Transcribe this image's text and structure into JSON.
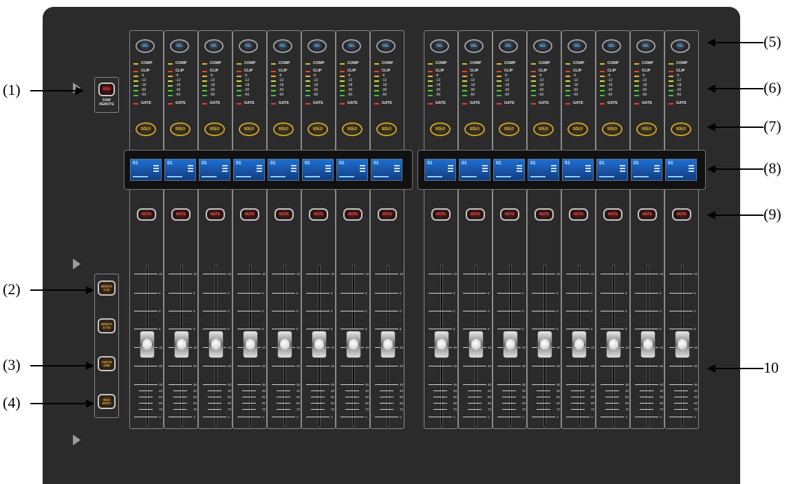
{
  "strips_left_count": 8,
  "strips_right_count": 8,
  "strip": {
    "sel_label": "SEL",
    "solo_label": "SOLO",
    "mute_label": "MUTE",
    "meter_labels": [
      "COMP",
      "CLIP",
      "-6",
      "-12",
      "-18",
      "-30",
      "-60",
      "GATE"
    ],
    "lcd_number": "01",
    "fader_scale": [
      "10",
      "5",
      "0",
      "5",
      "10",
      "20",
      "30",
      "40",
      "50",
      "60",
      "70",
      "∞"
    ]
  },
  "daw_remote": {
    "button_label": "REM",
    "label_line1": "DAW",
    "label_line2": "REMOTE"
  },
  "side_buttons": [
    {
      "line1": "INPUTS",
      "line2": "1-16"
    },
    {
      "line1": "INPUTS",
      "line2": "17-32"
    },
    {
      "line1": "AUX IN",
      "line2": "USB"
    },
    {
      "line1": "BUS",
      "line2": "MAST"
    }
  ],
  "callouts": {
    "c1": "(1)",
    "c2": "(2)",
    "c3": "(3)",
    "c4": "(4)",
    "c5": "(5)",
    "c6": "(6)",
    "c7": "(7)",
    "c8": "(8)",
    "c9": "(9)",
    "c10": "10"
  },
  "colors": {
    "console": "#2b2b2b",
    "lcd": "#1f6fd0",
    "mute": "#ff4b3a",
    "solo": "#f0c040",
    "sel": "#4fb4ff"
  }
}
